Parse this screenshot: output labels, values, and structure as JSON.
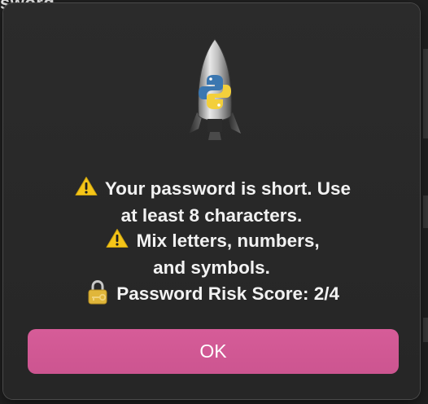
{
  "background": {
    "fragment_text": "sword"
  },
  "dialog": {
    "app_icon": "python-rocket-icon",
    "lines": [
      {
        "icon": "warning-icon",
        "text": "Your password is short. Use"
      },
      {
        "icon": "",
        "text": "at least 8 characters."
      },
      {
        "icon": "warning-icon",
        "text": "Mix letters, numbers,"
      },
      {
        "icon": "",
        "text": "and symbols."
      },
      {
        "icon": "lock-key-icon",
        "text": "Password Risk Score: 2/4"
      }
    ],
    "ok_label": "OK"
  },
  "colors": {
    "button": "#d65c98",
    "dialog_bg": "#2b2b2b",
    "text": "#f2f2f2",
    "warning_yellow": "#f5c518"
  }
}
